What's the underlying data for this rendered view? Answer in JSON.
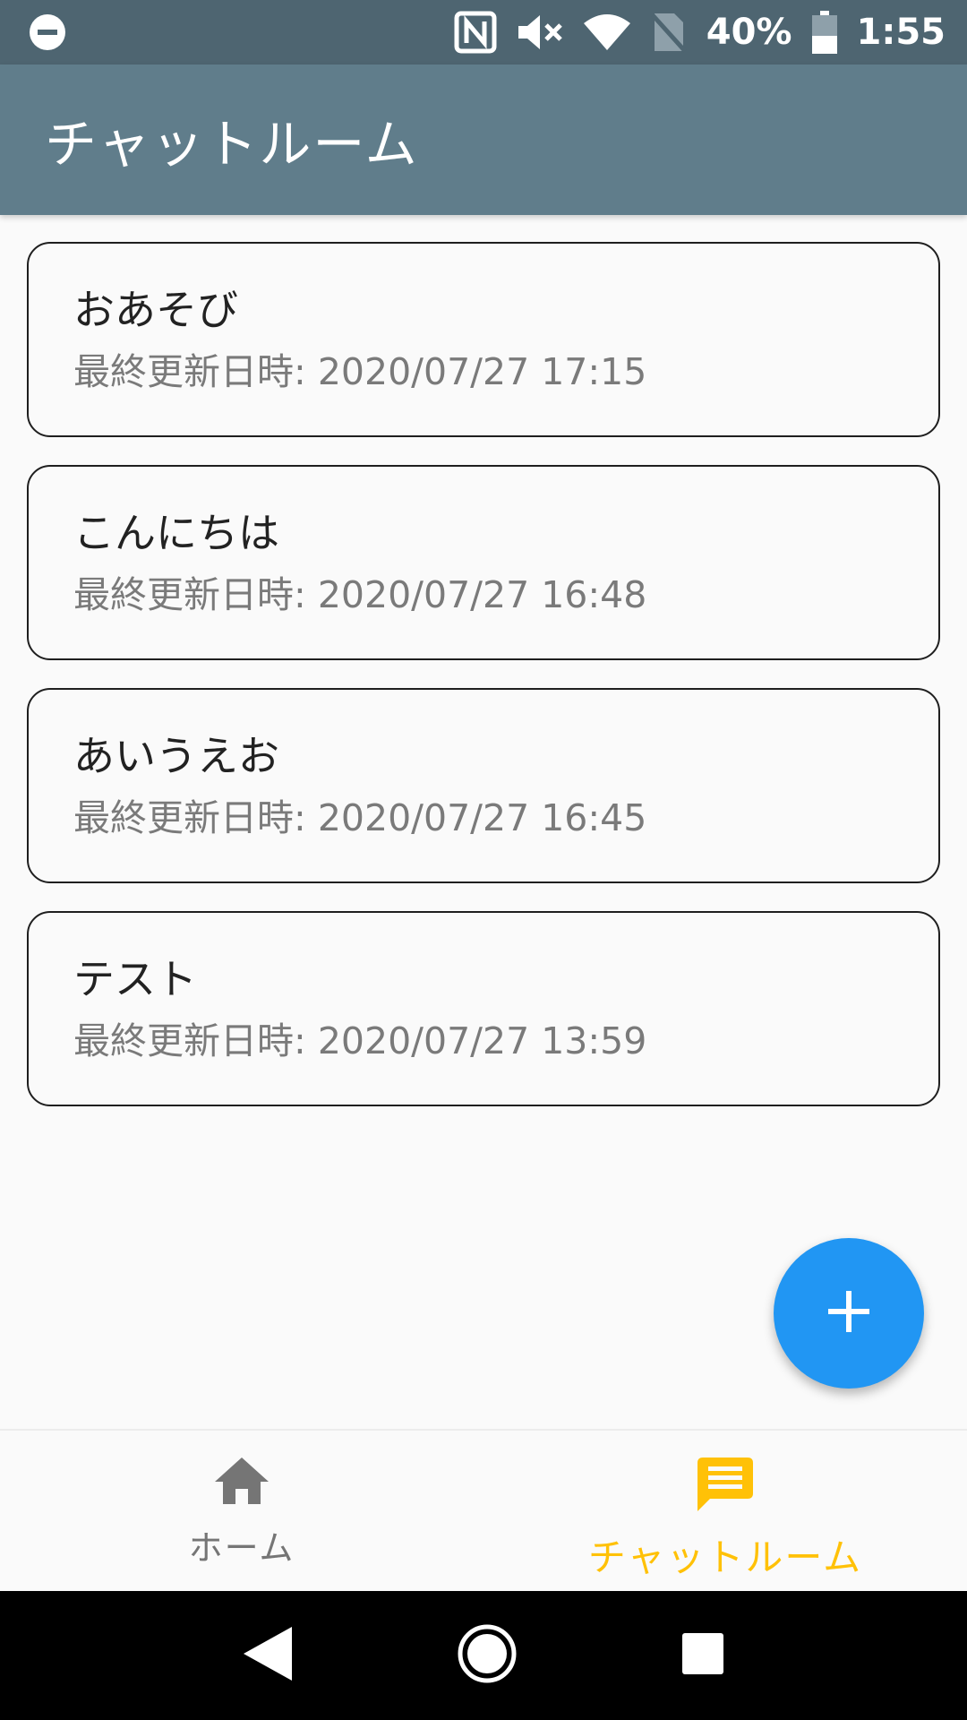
{
  "status_bar": {
    "battery": "40%",
    "time": "1:55",
    "icons": [
      "do-not-disturb-icon",
      "nfc-icon",
      "mute-icon",
      "wifi-icon",
      "no-sim-icon",
      "battery-icon"
    ]
  },
  "app_bar": {
    "title": "チャットルーム",
    "color": "#607d8b"
  },
  "rooms": [
    {
      "name": "おあそび",
      "updated": "最終更新日時: 2020/07/27 17:15"
    },
    {
      "name": "こんにちは",
      "updated": "最終更新日時: 2020/07/27 16:48"
    },
    {
      "name": "あいうえお",
      "updated": "最終更新日時: 2020/07/27 16:45"
    },
    {
      "name": "テスト",
      "updated": "最終更新日時: 2020/07/27 13:59"
    }
  ],
  "fab": {
    "icon": "plus-icon",
    "color": "#2196f3"
  },
  "bottom_nav": {
    "items": [
      {
        "label": "ホーム",
        "icon": "home-icon",
        "active": false
      },
      {
        "label": "チャットルーム",
        "icon": "chat-icon",
        "active": true
      }
    ],
    "active_color": "#ffc107"
  },
  "system_nav": {
    "icons": [
      "back-icon",
      "home-circle-icon",
      "recents-icon"
    ]
  }
}
